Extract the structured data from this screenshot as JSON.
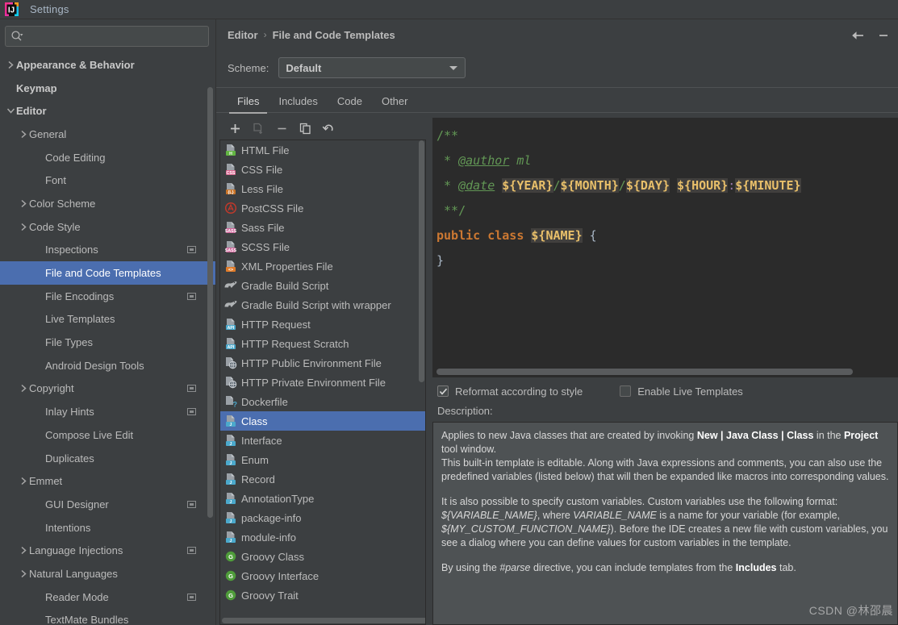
{
  "window": {
    "title": "Settings",
    "app_icon": "intellij-idea-logo"
  },
  "search": {
    "value": "",
    "placeholder": ""
  },
  "sidebar": {
    "items": [
      {
        "label": "Appearance & Behavior",
        "indent": 0,
        "arrow": "collapsed",
        "bold": true,
        "badge": false,
        "selected": false
      },
      {
        "label": "Keymap",
        "indent": 0,
        "arrow": "none",
        "bold": true,
        "badge": false,
        "selected": false
      },
      {
        "label": "Editor",
        "indent": 0,
        "arrow": "expanded",
        "bold": true,
        "badge": false,
        "selected": false
      },
      {
        "label": "General",
        "indent": 1,
        "arrow": "collapsed",
        "bold": false,
        "badge": false,
        "selected": false
      },
      {
        "label": "Code Editing",
        "indent": 2,
        "arrow": "none",
        "bold": false,
        "badge": false,
        "selected": false
      },
      {
        "label": "Font",
        "indent": 2,
        "arrow": "none",
        "bold": false,
        "badge": false,
        "selected": false
      },
      {
        "label": "Color Scheme",
        "indent": 1,
        "arrow": "collapsed",
        "bold": false,
        "badge": false,
        "selected": false
      },
      {
        "label": "Code Style",
        "indent": 1,
        "arrow": "collapsed",
        "bold": false,
        "badge": false,
        "selected": false
      },
      {
        "label": "Inspections",
        "indent": 2,
        "arrow": "none",
        "bold": false,
        "badge": true,
        "selected": false
      },
      {
        "label": "File and Code Templates",
        "indent": 2,
        "arrow": "none",
        "bold": false,
        "badge": false,
        "selected": true
      },
      {
        "label": "File Encodings",
        "indent": 2,
        "arrow": "none",
        "bold": false,
        "badge": true,
        "selected": false
      },
      {
        "label": "Live Templates",
        "indent": 2,
        "arrow": "none",
        "bold": false,
        "badge": false,
        "selected": false
      },
      {
        "label": "File Types",
        "indent": 2,
        "arrow": "none",
        "bold": false,
        "badge": false,
        "selected": false
      },
      {
        "label": "Android Design Tools",
        "indent": 2,
        "arrow": "none",
        "bold": false,
        "badge": false,
        "selected": false
      },
      {
        "label": "Copyright",
        "indent": 1,
        "arrow": "collapsed",
        "bold": false,
        "badge": true,
        "selected": false
      },
      {
        "label": "Inlay Hints",
        "indent": 2,
        "arrow": "none",
        "bold": false,
        "badge": true,
        "selected": false
      },
      {
        "label": "Compose Live Edit",
        "indent": 2,
        "arrow": "none",
        "bold": false,
        "badge": false,
        "selected": false
      },
      {
        "label": "Duplicates",
        "indent": 2,
        "arrow": "none",
        "bold": false,
        "badge": false,
        "selected": false
      },
      {
        "label": "Emmet",
        "indent": 1,
        "arrow": "collapsed",
        "bold": false,
        "badge": false,
        "selected": false
      },
      {
        "label": "GUI Designer",
        "indent": 2,
        "arrow": "none",
        "bold": false,
        "badge": true,
        "selected": false
      },
      {
        "label": "Intentions",
        "indent": 2,
        "arrow": "none",
        "bold": false,
        "badge": false,
        "selected": false
      },
      {
        "label": "Language Injections",
        "indent": 1,
        "arrow": "collapsed",
        "bold": false,
        "badge": true,
        "selected": false
      },
      {
        "label": "Natural Languages",
        "indent": 1,
        "arrow": "collapsed",
        "bold": false,
        "badge": false,
        "selected": false
      },
      {
        "label": "Reader Mode",
        "indent": 2,
        "arrow": "none",
        "bold": false,
        "badge": true,
        "selected": false
      },
      {
        "label": "TextMate Bundles",
        "indent": 2,
        "arrow": "none",
        "bold": false,
        "badge": false,
        "selected": false
      }
    ]
  },
  "breadcrumb": {
    "parent": "Editor",
    "separator": "›",
    "current": "File and Code Templates"
  },
  "nav": {
    "back_icon": "arrow-left-icon",
    "forward_icon": "arrow-right-icon"
  },
  "scheme": {
    "label": "Scheme:",
    "value": "Default",
    "arrow_icon": "chevron-down-icon"
  },
  "tabs": [
    {
      "label": "Files",
      "active": true
    },
    {
      "label": "Includes",
      "active": false
    },
    {
      "label": "Code",
      "active": false
    },
    {
      "label": "Other",
      "active": false
    }
  ],
  "list_toolbar": [
    {
      "name": "add-template-button",
      "icon": "plus-icon",
      "disabled": false
    },
    {
      "name": "create-from-file-button",
      "icon": "file-add-icon",
      "disabled": true
    },
    {
      "name": "remove-template-button",
      "icon": "minus-icon",
      "disabled": false
    },
    {
      "name": "copy-template-button",
      "icon": "copy-icon",
      "disabled": false
    },
    {
      "name": "reset-template-button",
      "icon": "undo-icon",
      "disabled": false
    }
  ],
  "templates": [
    {
      "label": "HTML File",
      "icon": "html-file-icon",
      "selected": false
    },
    {
      "label": "CSS File",
      "icon": "css-file-icon",
      "selected": false
    },
    {
      "label": "Less File",
      "icon": "less-file-icon",
      "selected": false
    },
    {
      "label": "PostCSS File",
      "icon": "postcss-file-icon",
      "selected": false
    },
    {
      "label": "Sass File",
      "icon": "sass-file-icon",
      "selected": false
    },
    {
      "label": "SCSS File",
      "icon": "scss-file-icon",
      "selected": false
    },
    {
      "label": "XML Properties File",
      "icon": "xml-properties-file-icon",
      "selected": false
    },
    {
      "label": "Gradle Build Script",
      "icon": "gradle-icon",
      "selected": false
    },
    {
      "label": "Gradle Build Script with wrapper",
      "icon": "gradle-icon",
      "selected": false
    },
    {
      "label": "HTTP Request",
      "icon": "http-request-icon",
      "selected": false
    },
    {
      "label": "HTTP Request Scratch",
      "icon": "http-request-icon",
      "selected": false
    },
    {
      "label": "HTTP Public Environment File",
      "icon": "http-env-icon",
      "selected": false
    },
    {
      "label": "HTTP Private Environment File",
      "icon": "http-env-icon",
      "selected": false
    },
    {
      "label": "Dockerfile",
      "icon": "dockerfile-icon",
      "selected": false
    },
    {
      "label": "Class",
      "icon": "java-class-icon",
      "selected": true
    },
    {
      "label": "Interface",
      "icon": "java-class-icon",
      "selected": false
    },
    {
      "label": "Enum",
      "icon": "java-class-icon",
      "selected": false
    },
    {
      "label": "Record",
      "icon": "java-class-icon",
      "selected": false
    },
    {
      "label": "AnnotationType",
      "icon": "java-class-icon",
      "selected": false
    },
    {
      "label": "package-info",
      "icon": "java-class-icon",
      "selected": false
    },
    {
      "label": "module-info",
      "icon": "java-class-icon",
      "selected": false
    },
    {
      "label": "Groovy Class",
      "icon": "groovy-icon",
      "selected": false
    },
    {
      "label": "Groovy Interface",
      "icon": "groovy-icon",
      "selected": false
    },
    {
      "label": "Groovy Trait",
      "icon": "groovy-icon",
      "selected": false
    }
  ],
  "editor": {
    "lines": [
      "/**",
      " * @author ml",
      " * @date ${YEAR}/${MONTH}/${DAY} ${HOUR}:${MINUTE}",
      " **/",
      "public class ${NAME} {",
      "}"
    ],
    "tokens": {
      "comment_open": "/**",
      "star": " * ",
      "author_tag": "@author",
      "author_value": " ml",
      "date_tag": "@date",
      "var_year": "${YEAR}",
      "var_month": "${MONTH}",
      "var_day": "${DAY}",
      "var_hour": "${HOUR}",
      "var_minute": "${MINUTE}",
      "slash": "/",
      "colon": ":",
      "space": " ",
      "comment_close": " **/",
      "kw_public": "public",
      "kw_class": "class",
      "var_name": "${NAME}",
      "brace_open": " {",
      "brace_close": "}"
    }
  },
  "options": {
    "reformat": {
      "label": "Reformat according to style",
      "checked": true
    },
    "live_templates": {
      "label": "Enable Live Templates",
      "checked": false
    }
  },
  "description": {
    "label": "Description:",
    "paragraphs": [
      [
        {
          "t": "Applies to new Java classes that are created by invoking ",
          "b": false,
          "i": false
        },
        {
          "t": "New | Java Class | Class",
          "b": true,
          "i": false
        },
        {
          "t": " in the ",
          "b": false,
          "i": false
        },
        {
          "t": "Project",
          "b": true,
          "i": false
        },
        {
          "t": " tool window.",
          "b": false,
          "i": false
        }
      ],
      [
        {
          "t": "This built-in template is editable. Along with Java expressions and comments, you can also use the predefined variables (listed below) that will then be expanded like macros into corresponding values.",
          "b": false,
          "i": false
        }
      ],
      [
        {
          "t": "It is also possible to specify custom variables. Custom variables use the following format: ",
          "b": false,
          "i": false
        },
        {
          "t": "${VARIABLE_NAME}",
          "b": false,
          "i": true
        },
        {
          "t": ", where ",
          "b": false,
          "i": false
        },
        {
          "t": "VARIABLE_NAME",
          "b": false,
          "i": true
        },
        {
          "t": " is a name for your variable (for example, ",
          "b": false,
          "i": false
        },
        {
          "t": "${MY_CUSTOM_FUNCTION_NAME}",
          "b": false,
          "i": true
        },
        {
          "t": "). Before the IDE creates a new file with custom variables, you see a dialog where you can define values for custom variables in the template.",
          "b": false,
          "i": false
        }
      ],
      [
        {
          "t": "By using the ",
          "b": false,
          "i": false
        },
        {
          "t": "#parse",
          "b": false,
          "i": true
        },
        {
          "t": " directive, you can include templates from the ",
          "b": false,
          "i": false
        },
        {
          "t": "Includes",
          "b": true,
          "i": false
        },
        {
          "t": " tab.",
          "b": false,
          "i": false
        }
      ]
    ]
  },
  "watermark": {
    "text": "CSDN @林邵晨"
  },
  "colors": {
    "window_bg": "#3c3f41",
    "selection_blue": "#4b6eaf",
    "editor_bg": "#2b2b2b",
    "comment_green": "#629755",
    "keyword_orange": "#cc7832",
    "variable_purple": "#9876aa",
    "brace_yellow": "#e8bf6a",
    "text_gray": "#bbbbbb",
    "desc_bg": "#4e5254"
  }
}
